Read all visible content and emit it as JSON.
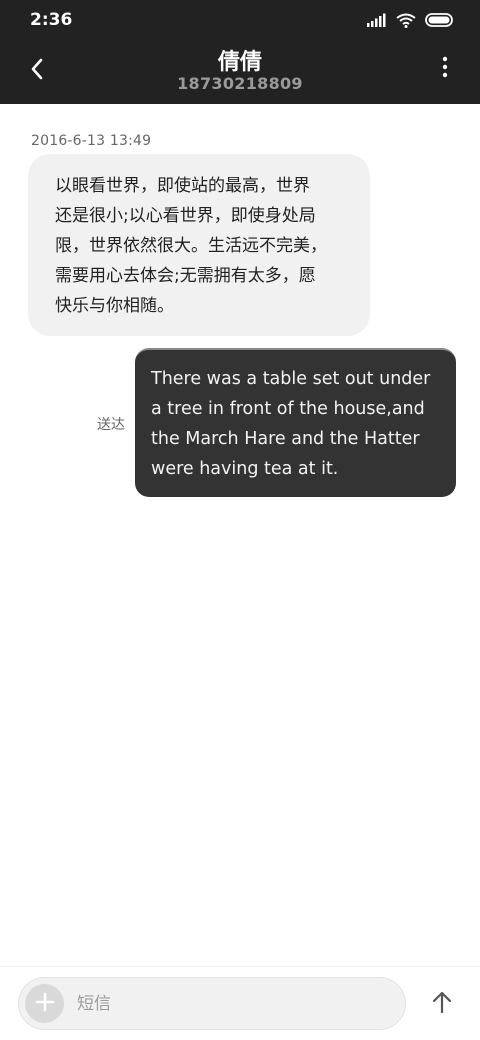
{
  "status_bar": {
    "time": "2:36",
    "icons": [
      "signal-icon",
      "wifi-icon",
      "battery-icon"
    ]
  },
  "app_bar": {
    "back_icon": "back-arrow-icon",
    "contact_name": "倩倩",
    "contact_number": "18730218809",
    "more_icon": "more-vertical-icon"
  },
  "conversation": {
    "timestamp": "2016-6-13 13:49",
    "incoming_message": {
      "lines": [
        "以眼看世界，即使站的最高，世界",
        "还是很小;以心看世界，即使身处局",
        "限，世界依然很大。生活远不完美，",
        "需要用心去体会;无需拥有太多，愿",
        "快乐与你相随。"
      ]
    },
    "outgoing_message": {
      "lines": [
        "There was a table set out under",
        "a tree in front of the house,and",
        "the March Hare and the Hatter",
        "were having tea at it."
      ],
      "status": "送达"
    }
  },
  "composer": {
    "attach_icon": "plus-icon",
    "placeholder": "短信",
    "value": "",
    "send_icon": "send-arrow-up-icon"
  },
  "colors": {
    "header_bg": "#222222",
    "incoming_bubble": "#f1f1f1",
    "outgoing_bubble": "#333333"
  }
}
